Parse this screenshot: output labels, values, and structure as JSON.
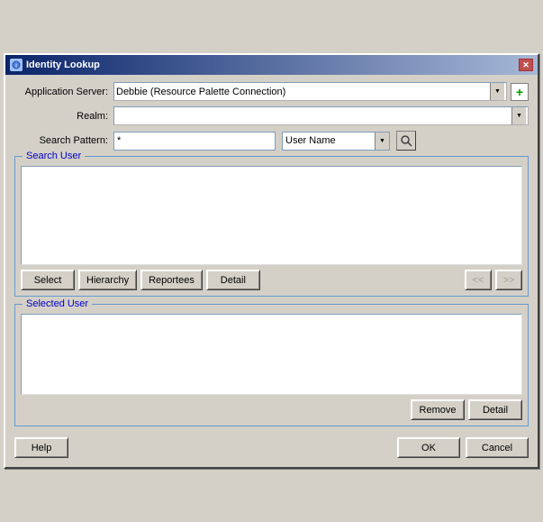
{
  "window": {
    "title": "Identity Lookup",
    "close_button": "✕"
  },
  "form": {
    "app_server_label": "Application Server:",
    "app_server_value": "Debbie (Resource Palette Connection)",
    "realm_label": "Realm:",
    "realm_value": "",
    "search_pattern_label": "Search Pattern:",
    "search_pattern_value": "*",
    "search_type_value": "User Name"
  },
  "search_user": {
    "label": "Search User",
    "select_btn": "Select",
    "hierarchy_btn": "Hierarchy",
    "reportees_btn": "Reportees",
    "detail_btn": "Detail",
    "prev_btn": "<<",
    "next_btn": ">>"
  },
  "selected_user": {
    "label": "Selected User",
    "remove_btn": "Remove",
    "detail_btn": "Detail"
  },
  "footer": {
    "help_btn": "Help",
    "ok_btn": "OK",
    "cancel_btn": "Cancel"
  },
  "icons": {
    "add": "+",
    "search": "🔍",
    "window_icon": "🔍"
  }
}
